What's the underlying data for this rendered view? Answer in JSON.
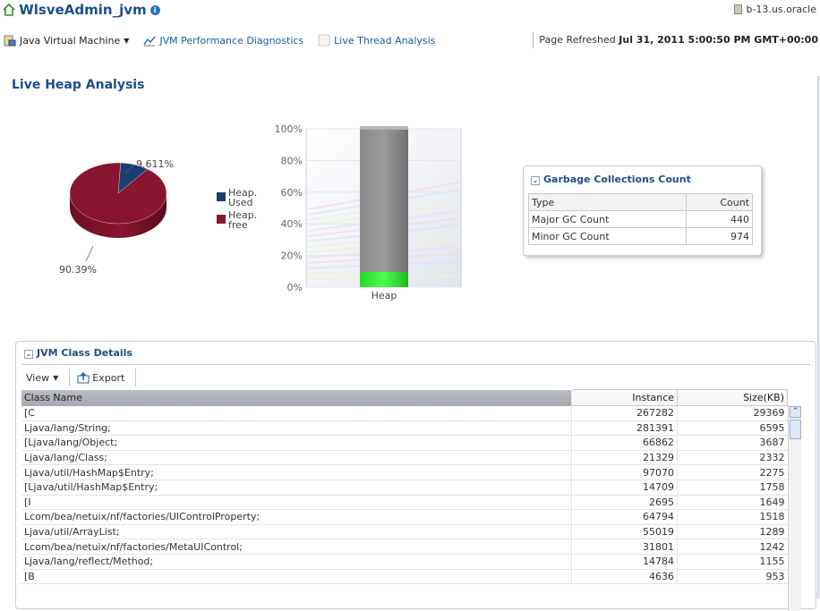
{
  "header": {
    "title": "WlsveAdmin_jvm",
    "host": "b-13.us.oracle",
    "nav": [
      "Java Virtual Machine",
      "JVM Performance Diagnostics",
      "Live Thread Analysis"
    ],
    "refresh_label": "Page Refreshed",
    "refresh_time": "Jul 31, 2011 5:00:50 PM GMT+00:00"
  },
  "section_title": "Live Heap Analysis",
  "colors": {
    "used": "#1b3f73",
    "free": "#8a1530",
    "accent": "#1b4f8a"
  },
  "chart_data": [
    {
      "type": "pie",
      "labels": [
        "Heap Used",
        "Heap free"
      ],
      "values": [
        9.611,
        90.39
      ],
      "data_labels": [
        "9.611%",
        "90.39%"
      ],
      "legend": [
        "Heap Used",
        "Heap free"
      ],
      "legend_placement": "right"
    },
    {
      "type": "bar",
      "stacked": true,
      "categories": [
        "Heap"
      ],
      "series": [
        {
          "name": "Heap Used",
          "values": [
            9.611
          ]
        },
        {
          "name": "Heap free",
          "values": [
            90.39
          ]
        }
      ],
      "ylim": [
        0,
        100
      ],
      "yticks": [
        "0%",
        "20%",
        "40%",
        "60%",
        "80%",
        "100%"
      ],
      "grid": true
    }
  ],
  "gc": {
    "title": "Garbage Collections Count",
    "headers": [
      "Type",
      "Count"
    ],
    "rows": [
      {
        "type": "Major GC Count",
        "count": "440"
      },
      {
        "type": "Minor GC Count",
        "count": "974"
      }
    ]
  },
  "class_details": {
    "title": "JVM Class Details",
    "view_label": "View",
    "export_label": "Export",
    "headers": [
      "Class Name",
      "Instance",
      "Size(KB)"
    ],
    "rows": [
      {
        "name": "[C",
        "instance": "267282",
        "size": "29369"
      },
      {
        "name": "Ljava/lang/String;",
        "instance": "281391",
        "size": "6595"
      },
      {
        "name": "[Ljava/lang/Object;",
        "instance": "66862",
        "size": "3687"
      },
      {
        "name": "Ljava/lang/Class;",
        "instance": "21329",
        "size": "2332"
      },
      {
        "name": "Ljava/util/HashMap$Entry;",
        "instance": "97070",
        "size": "2275"
      },
      {
        "name": "[Ljava/util/HashMap$Entry;",
        "instance": "14709",
        "size": "1758"
      },
      {
        "name": "[I",
        "instance": "2695",
        "size": "1649"
      },
      {
        "name": "Lcom/bea/netuix/nf/factories/UIControlProperty;",
        "instance": "64794",
        "size": "1518"
      },
      {
        "name": "Ljava/util/ArrayList;",
        "instance": "55019",
        "size": "1289"
      },
      {
        "name": "Lcom/bea/netuix/nf/factories/MetaUIControl;",
        "instance": "31801",
        "size": "1242"
      },
      {
        "name": "Ljava/lang/reflect/Method;",
        "instance": "14784",
        "size": "1155"
      },
      {
        "name": "[B",
        "instance": "4636",
        "size": "953"
      }
    ]
  }
}
